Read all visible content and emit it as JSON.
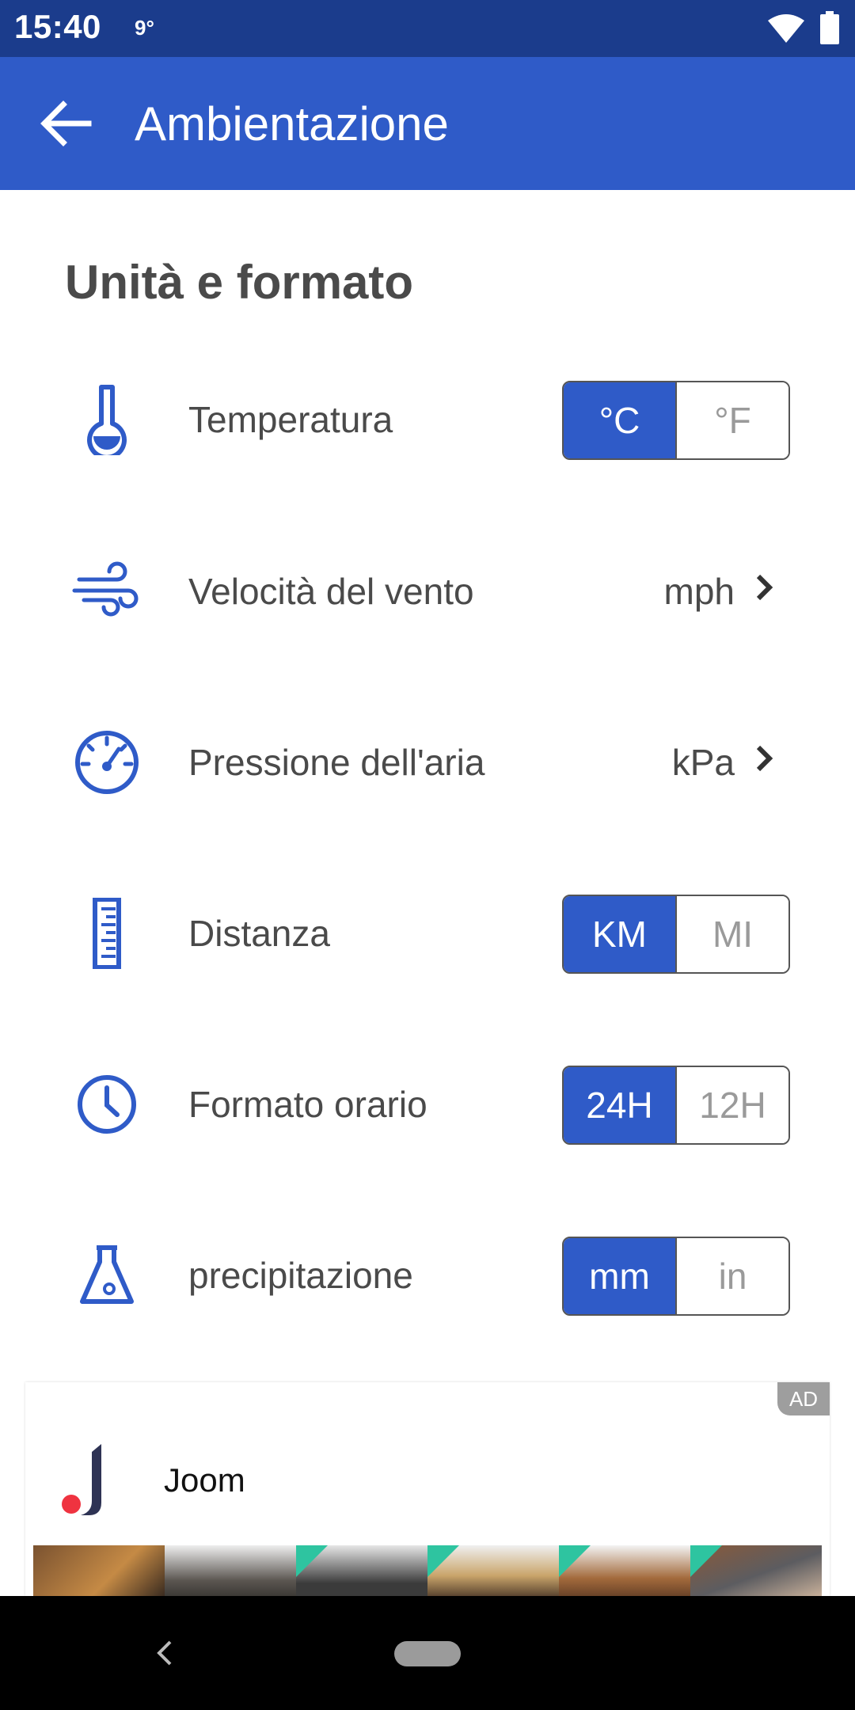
{
  "status_bar": {
    "time": "15:40",
    "temp": "9°"
  },
  "app_bar": {
    "title": "Ambientazione"
  },
  "section": {
    "title": "Unità e formato"
  },
  "settings": {
    "temperature": {
      "label": "Temperatura",
      "options": [
        "°C",
        "°F"
      ],
      "selected": "°C"
    },
    "wind": {
      "label": "Velocità del vento",
      "value": "mph"
    },
    "pressure": {
      "label": "Pressione dell'aria",
      "value": "kPa"
    },
    "distance": {
      "label": "Distanza",
      "options": [
        "KM",
        "MI"
      ],
      "selected": "KM"
    },
    "time_format": {
      "label": "Formato orario",
      "options": [
        "24H",
        "12H"
      ],
      "selected": "24H"
    },
    "precipitation": {
      "label": "precipitazione",
      "options": [
        "mm",
        "in"
      ],
      "selected": "mm"
    }
  },
  "ad": {
    "badge": "AD",
    "advertiser": "Joom"
  },
  "colors": {
    "accent": "#2f5bc8",
    "status_bar": "#1b3c8c",
    "text": "#4a4a4a"
  },
  "icons": [
    "thermometer-icon",
    "wind-icon",
    "gauge-icon",
    "ruler-icon",
    "clock-icon",
    "flask-icon"
  ]
}
